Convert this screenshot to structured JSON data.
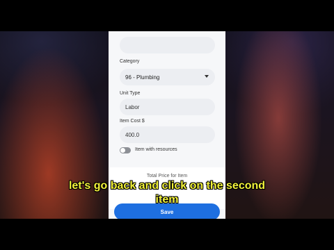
{
  "form": {
    "category_label": "Category",
    "category_value": "96 - Plumbing",
    "unit_type_label": "Unit Type",
    "unit_type_value": "Labor",
    "item_cost_label": "Item Cost $",
    "item_cost_value": "400.0",
    "toggle_label": "Item with resources",
    "toggle_on": false
  },
  "summary": {
    "total_label": "Total Price for Item"
  },
  "actions": {
    "save_label": "Save"
  },
  "caption": {
    "line1": "let's go back and click on the second",
    "line2": "item"
  },
  "colors": {
    "accent": "#1e6fe0",
    "caption": "#f2f23a"
  }
}
